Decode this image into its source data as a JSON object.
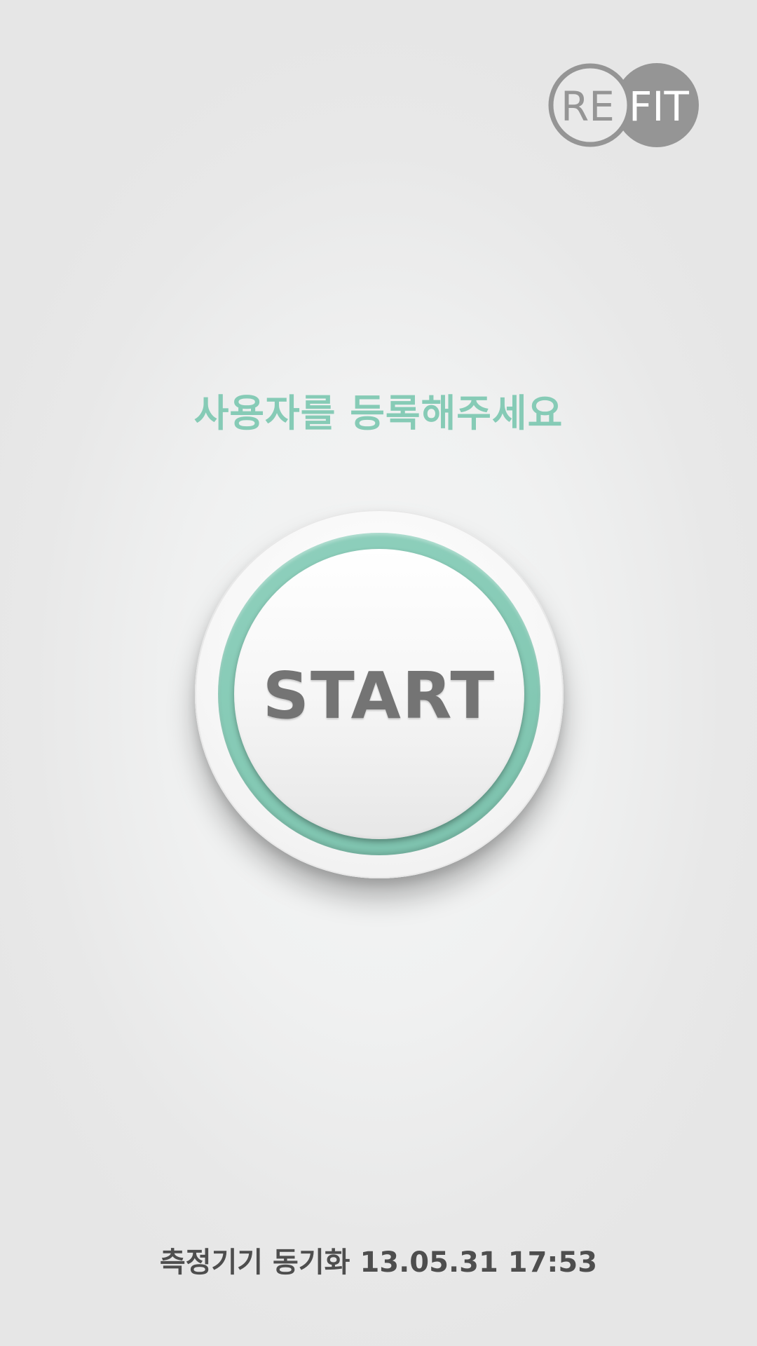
{
  "logo": {
    "left_text": "RE",
    "right_text": "FIT"
  },
  "prompt": {
    "text": "사용자를 등록해주세요"
  },
  "start_button": {
    "label": "START"
  },
  "sync": {
    "label": "측정기기 동기화",
    "datetime": "13.05.31 17:53"
  },
  "colors": {
    "accent": "#86cbb6",
    "logo_gray": "#959595",
    "start_text": "#747474",
    "footer_text": "#4e4e4e"
  }
}
